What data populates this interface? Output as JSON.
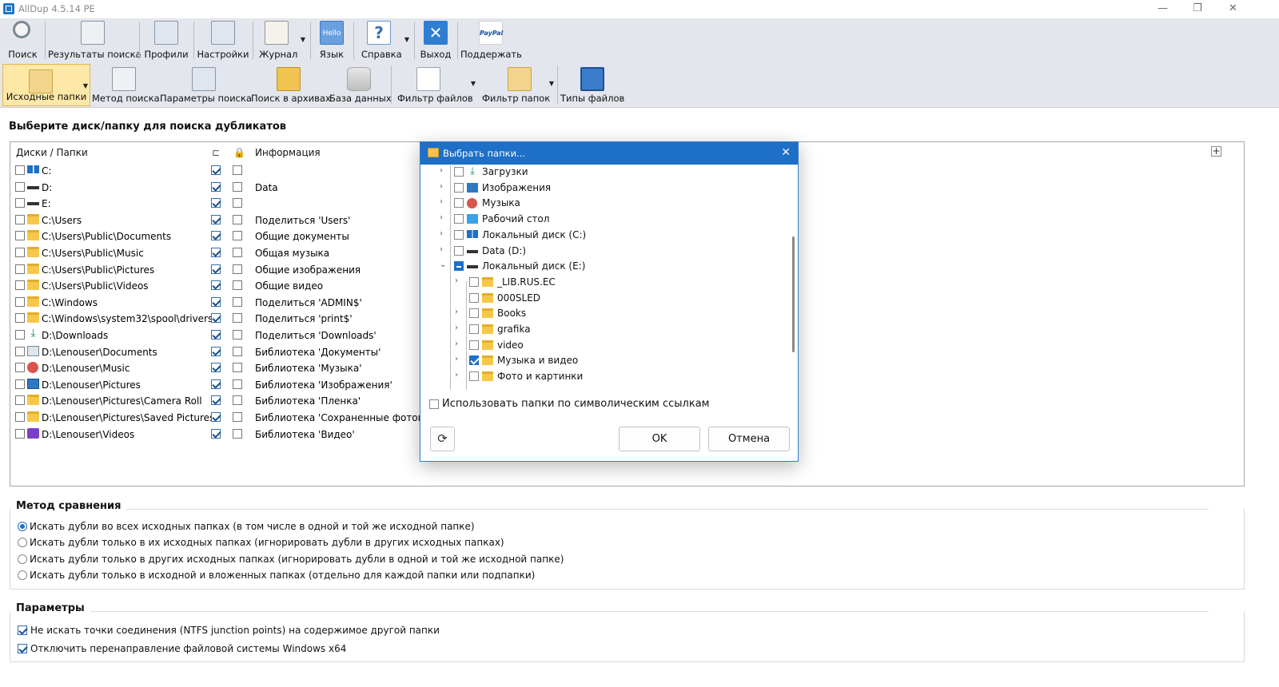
{
  "window": {
    "title": "AllDup 4.5.14 PE"
  },
  "toolbar_main": [
    {
      "label": "Поиск",
      "icon": "magnifier-icon"
    },
    {
      "label": "Результаты поиска",
      "icon": "results-icon"
    },
    {
      "label": "Профили",
      "icon": "profiles-icon"
    },
    {
      "label": "Настройки",
      "icon": "settings-icon"
    },
    {
      "label": "Журнал",
      "icon": "journal-icon"
    },
    {
      "label": "Язык",
      "icon": "language-icon",
      "icon_text": "Hello"
    },
    {
      "label": "Справка",
      "icon": "help-icon",
      "icon_text": "?"
    },
    {
      "label": "Выход",
      "icon": "exit-icon",
      "icon_text": "✕"
    },
    {
      "label": "Поддержать",
      "icon": "paypal-icon",
      "icon_text": "PayPal"
    }
  ],
  "toolbar_sub": [
    {
      "label": "Исходные папки",
      "icon": "source-folders-icon"
    },
    {
      "label": "Метод поиска",
      "icon": "search-method-icon"
    },
    {
      "label": "Параметры поиска",
      "icon": "search-params-icon"
    },
    {
      "label": "Поиск в архивах",
      "icon": "archive-icon"
    },
    {
      "label": "База данных",
      "icon": "database-icon"
    },
    {
      "label": "Фильтр файлов",
      "icon": "file-filter-icon"
    },
    {
      "label": "Фильтр папок",
      "icon": "folder-filter-icon"
    },
    {
      "label": "Типы файлов",
      "icon": "file-types-icon"
    }
  ],
  "section_title": "Выберите диск/папку для поиска дубликатов",
  "folders_table": {
    "col_path": "Диски / Папки",
    "col_sub_icon": "subfolders-icon",
    "col_lock_icon": "lock-icon",
    "col_info": "Информация",
    "rows": [
      {
        "path": "C:",
        "icon": "windows-drive",
        "sub": true,
        "lock": false,
        "info": ""
      },
      {
        "path": "D:",
        "icon": "drive",
        "sub": true,
        "lock": false,
        "info": "Data"
      },
      {
        "path": "E:",
        "icon": "drive",
        "sub": true,
        "lock": false,
        "info": ""
      },
      {
        "path": "C:\\Users",
        "icon": "folder",
        "sub": true,
        "lock": false,
        "info": "Поделиться 'Users'"
      },
      {
        "path": "C:\\Users\\Public\\Documents",
        "icon": "folder",
        "sub": true,
        "lock": false,
        "info": "Общие документы"
      },
      {
        "path": "C:\\Users\\Public\\Music",
        "icon": "folder",
        "sub": true,
        "lock": false,
        "info": "Общая музыка"
      },
      {
        "path": "C:\\Users\\Public\\Pictures",
        "icon": "folder",
        "sub": true,
        "lock": false,
        "info": "Общие изображения"
      },
      {
        "path": "C:\\Users\\Public\\Videos",
        "icon": "folder",
        "sub": true,
        "lock": false,
        "info": "Общие видео"
      },
      {
        "path": "C:\\Windows",
        "icon": "folder",
        "sub": true,
        "lock": false,
        "info": "Поделиться 'ADMIN$'"
      },
      {
        "path": "C:\\Windows\\system32\\spool\\drivers",
        "icon": "folder",
        "sub": true,
        "lock": false,
        "info": "Поделиться 'print$'"
      },
      {
        "path": "D:\\Downloads",
        "icon": "download",
        "sub": true,
        "lock": false,
        "info": "Поделиться 'Downloads'"
      },
      {
        "path": "D:\\Lenouser\\Documents",
        "icon": "document",
        "sub": true,
        "lock": false,
        "info": "Библиотека 'Документы'"
      },
      {
        "path": "D:\\Lenouser\\Music",
        "icon": "music",
        "sub": true,
        "lock": false,
        "info": "Библиотека 'Музыка'"
      },
      {
        "path": "D:\\Lenouser\\Pictures",
        "icon": "pictures",
        "sub": true,
        "lock": false,
        "info": "Библиотека 'Изображения'"
      },
      {
        "path": "D:\\Lenouser\\Pictures\\Camera Roll",
        "icon": "folder",
        "sub": true,
        "lock": false,
        "info": "Библиотека 'Пленка'"
      },
      {
        "path": "D:\\Lenouser\\Pictures\\Saved Pictures",
        "icon": "folder",
        "sub": true,
        "lock": false,
        "info": "Библиотека 'Сохраненные фотогра"
      },
      {
        "path": "D:\\Lenouser\\Videos",
        "icon": "video",
        "sub": true,
        "lock": false,
        "info": "Библиотека 'Видео'"
      }
    ]
  },
  "method": {
    "title": "Метод сравнения",
    "selected": 0,
    "options": [
      "Искать дубли во всех исходных папках (в том числе в одной и той же исходной папке)",
      "Искать дубли только в их исходных папках (игнорировать дубли в других исходных папках)",
      "Искать дубли только в других исходных папках (игнорировать дубли в одной и той же исходной папке)",
      "Искать дубли только в исходной и вложенных папках (отдельно для каждой папки или подпапки)"
    ]
  },
  "params": {
    "title": "Параметры",
    "options": [
      {
        "label": "Не искать точки соединения (NTFS junction points) на содержимое другой папки",
        "checked": true
      },
      {
        "label": "Отключить перенаправление файловой системы Windows x64",
        "checked": true
      }
    ]
  },
  "dialog": {
    "title": "Выбрать папки...",
    "tree": [
      {
        "label": "Загрузки",
        "level": 0,
        "icon": "download",
        "arrow": "›",
        "check": "off"
      },
      {
        "label": "Изображения",
        "level": 0,
        "icon": "pictures",
        "arrow": "›",
        "check": "off"
      },
      {
        "label": "Музыка",
        "level": 0,
        "icon": "music",
        "arrow": "›",
        "check": "off"
      },
      {
        "label": "Рабочий стол",
        "level": 0,
        "icon": "desktop",
        "arrow": "›",
        "check": "off"
      },
      {
        "label": "Локальный диск (C:)",
        "level": 0,
        "icon": "windows-drive",
        "arrow": "›",
        "check": "off"
      },
      {
        "label": "Data (D:)",
        "level": 0,
        "icon": "drive",
        "arrow": "›",
        "check": "off"
      },
      {
        "label": "Локальный диск (E:)",
        "level": 0,
        "icon": "drive",
        "arrow": "⌄",
        "check": "partial"
      },
      {
        "label": "_LIB.RUS.EC",
        "level": 1,
        "icon": "folder",
        "arrow": "›",
        "check": "off"
      },
      {
        "label": "000SLED",
        "level": 1,
        "icon": "folder",
        "arrow": "",
        "check": "off"
      },
      {
        "label": "Books",
        "level": 1,
        "icon": "folder",
        "arrow": "›",
        "check": "off"
      },
      {
        "label": "grafika",
        "level": 1,
        "icon": "folder",
        "arrow": "›",
        "check": "off"
      },
      {
        "label": "video",
        "level": 1,
        "icon": "folder",
        "arrow": "›",
        "check": "off"
      },
      {
        "label": "Музыка и видео",
        "level": 1,
        "icon": "folder",
        "arrow": "›",
        "check": "on"
      },
      {
        "label": "Фото и картинки",
        "level": 1,
        "icon": "folder",
        "arrow": "›",
        "check": "off"
      }
    ],
    "symlink_label": "Использовать папки по символическим ссылкам",
    "symlink_checked": false,
    "ok_label": "OK",
    "cancel_label": "Отмена"
  }
}
